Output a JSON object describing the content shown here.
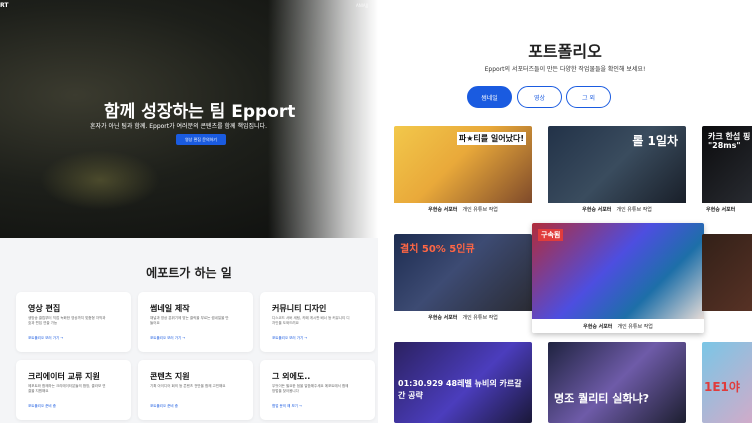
{
  "header": {
    "logo": "RT",
    "nav_right": "ANIAJJ"
  },
  "hero": {
    "title": "함께 성장하는 팀 Epport",
    "subtitle": "혼자가 아닌 팀과 함께. Epport가 여러분의 콘텐츠를 함께 책임집니다.",
    "button": "영상 편집 문의하기"
  },
  "services": {
    "title": "에포트가 하는 일",
    "cards": [
      {
        "title": "영상 편집",
        "desc": "생방송 클립부터 직접 녹화한 영상까지 맞춤형 자막과 효과 편집 연출 가능",
        "link": "포트폴리오 보러 가기 →"
      },
      {
        "title": "썸네일 제작",
        "desc": "채널과 영상 분위기에 맞는 클릭을 부르는 썸네일을 만들어요",
        "link": "포트폴리오 보러 가기 →"
      },
      {
        "title": "커뮤니티 디자인",
        "desc": "디스코드 서버 세팅, 카페 게시판 배너 등 커뮤니티 디자인을 도와드려요",
        "link": "포트폴리오 보러 가기 →"
      },
      {
        "title": "크리에이터 교류 지원",
        "desc": "에포트와 함께하는 크리에이터분들의 합방, 콜라보 연결을 지원해요",
        "link": "포트폴리오 준비 중"
      },
      {
        "title": "콘텐츠 지원",
        "desc": "기획 아이디어 회의 등 콘텐츠 전반을 함께 고민해요",
        "link": "포트폴리오 준비 중"
      },
      {
        "title": "그 외에도..",
        "desc": "무엇이든 필요한 점을 말씀해주세요 에포트에서 함께 방법을 찾아봅니다",
        "link": "협업 문의 해 보기 →"
      }
    ]
  },
  "portfolio": {
    "title": "포트폴리오",
    "subtitle": "Epport의 서포터즈들이 만든 다양한 작업물들을 확인해 보세요!",
    "tabs": [
      "썸네일",
      "영상",
      "그 외"
    ],
    "tiles": [
      {
        "author": "우현승 서포터",
        "desc": "개인 유튜브 작업",
        "overlay": "파★티를 일어났다!"
      },
      {
        "author": "우현승 서포터",
        "desc": "개인 유튜브 작업",
        "overlay": "롤 1일차"
      },
      {
        "author": "우현승 서포터",
        "desc": "개인 유튜브 작업",
        "overlay": "카크 한섭 핑 \"28ms\""
      },
      {
        "author": "우현승 서포터",
        "desc": "개인 유튜브 작업",
        "overlay": "결치 50% 5인큐"
      },
      {
        "author": "우현승 서포터",
        "desc": "개인 유튜브 작업",
        "overlay": "구속됨"
      },
      {
        "author": "",
        "desc": "",
        "overlay": ""
      },
      {
        "author": "",
        "desc": "",
        "overlay": "01:30.929 48레벨 뉴비의 카르갈간 공략"
      },
      {
        "author": "",
        "desc": "",
        "overlay": "명조 퀄리티 실화냐?"
      },
      {
        "author": "",
        "desc": "",
        "overlay": "1E1야"
      }
    ]
  },
  "colors": {
    "accent": "#1a5be0",
    "hero_bg": "#141512"
  }
}
